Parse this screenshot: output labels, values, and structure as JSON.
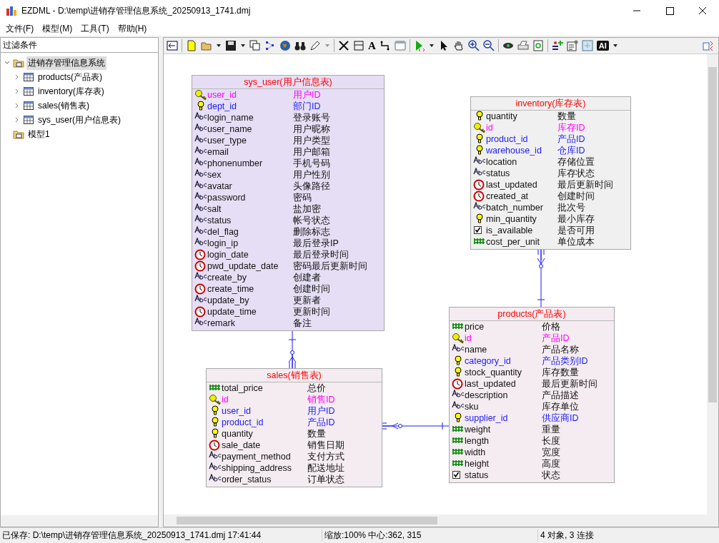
{
  "window": {
    "title": "EZDML - D:\\temp\\进销存管理信息系统_20250913_1741.dmj"
  },
  "menu": [
    "文件(F)",
    "模型(M)",
    "工具(T)",
    "帮助(H)"
  ],
  "filter": {
    "label": "过滤条件"
  },
  "tree": [
    {
      "label": "进销存管理信息系统",
      "selected": true,
      "expanded": true,
      "children": [
        {
          "label": "products(产品表)",
          "selected": false,
          "expanded": false
        },
        {
          "label": "inventory(库存表)",
          "selected": false,
          "expanded": false
        },
        {
          "label": "sales(销售表)",
          "selected": false,
          "expanded": false
        },
        {
          "label": "sys_user(用户信息表)",
          "selected": false,
          "expanded": false
        }
      ]
    },
    {
      "label": "模型1",
      "selected": false
    }
  ],
  "toolbar": {
    "text_tool": "A",
    "ai_button": "AI"
  },
  "tables": [
    {
      "title": "sys_user(用户信息表)",
      "color": "#e6def4",
      "fields": [
        {
          "name": "user_id",
          "comment": "用户ID",
          "kind": "key",
          "primary": true,
          "foreign": false
        },
        {
          "name": "dept_id",
          "comment": "部门ID",
          "kind": "index",
          "primary": false,
          "foreign": true
        },
        {
          "name": "login_name",
          "comment": "登录账号",
          "kind": "text",
          "primary": false,
          "foreign": false
        },
        {
          "name": "user_name",
          "comment": "用户昵称",
          "kind": "text",
          "primary": false,
          "foreign": false
        },
        {
          "name": "user_type",
          "comment": "用户类型",
          "kind": "text",
          "primary": false,
          "foreign": false
        },
        {
          "name": "email",
          "comment": "用户邮箱",
          "kind": "text",
          "primary": false,
          "foreign": false
        },
        {
          "name": "phonenumber",
          "comment": "手机号码",
          "kind": "text",
          "primary": false,
          "foreign": false
        },
        {
          "name": "sex",
          "comment": "用户性别",
          "kind": "text",
          "primary": false,
          "foreign": false
        },
        {
          "name": "avatar",
          "comment": "头像路径",
          "kind": "text",
          "primary": false,
          "foreign": false
        },
        {
          "name": "password",
          "comment": "密码",
          "kind": "text",
          "primary": false,
          "foreign": false
        },
        {
          "name": "salt",
          "comment": "盐加密",
          "kind": "text",
          "primary": false,
          "foreign": false
        },
        {
          "name": "status",
          "comment": "帐号状态",
          "kind": "text",
          "primary": false,
          "foreign": false
        },
        {
          "name": "del_flag",
          "comment": "删除标志",
          "kind": "text",
          "primary": false,
          "foreign": false
        },
        {
          "name": "login_ip",
          "comment": "最后登录IP",
          "kind": "text",
          "primary": false,
          "foreign": false
        },
        {
          "name": "login_date",
          "comment": "最后登录时间",
          "kind": "date",
          "primary": false,
          "foreign": false
        },
        {
          "name": "pwd_update_date",
          "comment": "密码最后更新时间",
          "kind": "date",
          "primary": false,
          "foreign": false
        },
        {
          "name": "create_by",
          "comment": "创建者",
          "kind": "text",
          "primary": false,
          "foreign": false
        },
        {
          "name": "create_time",
          "comment": "创建时间",
          "kind": "date",
          "primary": false,
          "foreign": false
        },
        {
          "name": "update_by",
          "comment": "更新者",
          "kind": "text",
          "primary": false,
          "foreign": false
        },
        {
          "name": "update_time",
          "comment": "更新时间",
          "kind": "date",
          "primary": false,
          "foreign": false
        },
        {
          "name": "remark",
          "comment": "备注",
          "kind": "text",
          "primary": false,
          "foreign": false
        }
      ]
    },
    {
      "title": "inventory(库存表)",
      "color": "#f0f0f0",
      "fields": [
        {
          "name": "quantity",
          "comment": "数量",
          "kind": "index",
          "primary": false,
          "foreign": false
        },
        {
          "name": "id",
          "comment": "库存ID",
          "kind": "key",
          "primary": true,
          "foreign": false
        },
        {
          "name": "product_id",
          "comment": "产品ID",
          "kind": "index",
          "primary": false,
          "foreign": true
        },
        {
          "name": "warehouse_id",
          "comment": "仓库ID",
          "kind": "index",
          "primary": false,
          "foreign": true
        },
        {
          "name": "location",
          "comment": "存储位置",
          "kind": "text",
          "primary": false,
          "foreign": false
        },
        {
          "name": "status",
          "comment": "库存状态",
          "kind": "text",
          "primary": false,
          "foreign": false
        },
        {
          "name": "last_updated",
          "comment": "最后更新时间",
          "kind": "date",
          "primary": false,
          "foreign": false
        },
        {
          "name": "created_at",
          "comment": "创建时间",
          "kind": "date",
          "primary": false,
          "foreign": false
        },
        {
          "name": "batch_number",
          "comment": "批次号",
          "kind": "text",
          "primary": false,
          "foreign": false
        },
        {
          "name": "min_quantity",
          "comment": "最小库存",
          "kind": "index",
          "primary": false,
          "foreign": false
        },
        {
          "name": "is_available",
          "comment": "是否可用",
          "kind": "bool",
          "primary": false,
          "foreign": false
        },
        {
          "name": "cost_per_unit",
          "comment": "单位成本",
          "kind": "number",
          "primary": false,
          "foreign": false
        }
      ]
    },
    {
      "title": "products(产品表)",
      "color": "#f4ecf0",
      "fields": [
        {
          "name": "price",
          "comment": "价格",
          "kind": "number",
          "primary": false,
          "foreign": false
        },
        {
          "name": "id",
          "comment": "产品ID",
          "kind": "key",
          "primary": true,
          "foreign": false
        },
        {
          "name": "name",
          "comment": "产品名称",
          "kind": "text",
          "primary": false,
          "foreign": false
        },
        {
          "name": "category_id",
          "comment": "产品类别ID",
          "kind": "index",
          "primary": false,
          "foreign": true
        },
        {
          "name": "stock_quantity",
          "comment": "库存数量",
          "kind": "index",
          "primary": false,
          "foreign": false
        },
        {
          "name": "last_updated",
          "comment": "最后更新时间",
          "kind": "date",
          "primary": false,
          "foreign": false
        },
        {
          "name": "description",
          "comment": "产品描述",
          "kind": "text",
          "primary": false,
          "foreign": false
        },
        {
          "name": "sku",
          "comment": "库存单位",
          "kind": "text",
          "primary": false,
          "foreign": false
        },
        {
          "name": "supplier_id",
          "comment": "供应商ID",
          "kind": "index",
          "primary": false,
          "foreign": true
        },
        {
          "name": "weight",
          "comment": "重量",
          "kind": "number",
          "primary": false,
          "foreign": false
        },
        {
          "name": "length",
          "comment": "长度",
          "kind": "number",
          "primary": false,
          "foreign": false
        },
        {
          "name": "width",
          "comment": "宽度",
          "kind": "number",
          "primary": false,
          "foreign": false
        },
        {
          "name": "height",
          "comment": "高度",
          "kind": "number",
          "primary": false,
          "foreign": false
        },
        {
          "name": "status",
          "comment": "状态",
          "kind": "bool",
          "primary": false,
          "foreign": false
        }
      ]
    },
    {
      "title": "sales(销售表)",
      "color": "#f4ecf0",
      "fields": [
        {
          "name": "total_price",
          "comment": "总价",
          "kind": "number",
          "primary": false,
          "foreign": false
        },
        {
          "name": "id",
          "comment": "销售ID",
          "kind": "key",
          "primary": true,
          "foreign": false
        },
        {
          "name": "user_id",
          "comment": "用户ID",
          "kind": "index",
          "primary": false,
          "foreign": true
        },
        {
          "name": "product_id",
          "comment": "产品ID",
          "kind": "index",
          "primary": false,
          "foreign": true
        },
        {
          "name": "quantity",
          "comment": "数量",
          "kind": "index",
          "primary": false,
          "foreign": false
        },
        {
          "name": "sale_date",
          "comment": "销售日期",
          "kind": "date",
          "primary": false,
          "foreign": false
        },
        {
          "name": "payment_method",
          "comment": "支付方式",
          "kind": "text",
          "primary": false,
          "foreign": false
        },
        {
          "name": "shipping_address",
          "comment": "配送地址",
          "kind": "text",
          "primary": false,
          "foreign": false
        },
        {
          "name": "order_status",
          "comment": "订单状态",
          "kind": "text",
          "primary": false,
          "foreign": false
        }
      ]
    }
  ],
  "status_bar": [
    "已保存: D:\\temp\\进销存管理信息系统_20250913_1741.dmj 17:41:44",
    "缩放:100% 中心:362, 315",
    "4 对象, 3 连接"
  ]
}
